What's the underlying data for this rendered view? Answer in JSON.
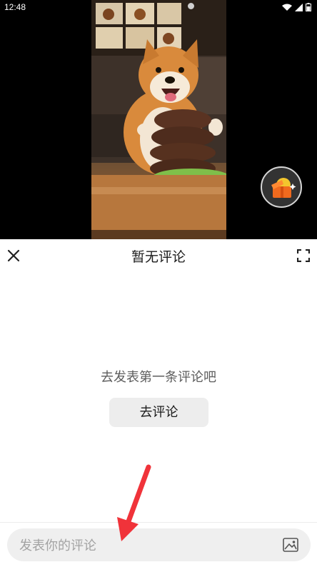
{
  "status_bar": {
    "time": "12:48",
    "icons": [
      "wifi-icon",
      "signal-icon",
      "battery-icon"
    ]
  },
  "video": {
    "gift_icon": "gift-box-icon"
  },
  "comments": {
    "title": "暂无评论",
    "empty_text": "去发表第一条评论吧",
    "go_comment_label": "去评论",
    "input_placeholder": "发表你的评论",
    "close_icon": "close-icon",
    "fullscreen_icon": "fullscreen-icon",
    "image_icon": "image-icon"
  },
  "colors": {
    "sheet_bg": "#ffffff",
    "button_bg": "#ededed",
    "input_bg": "#efefef",
    "annotation": "#f0333a"
  }
}
